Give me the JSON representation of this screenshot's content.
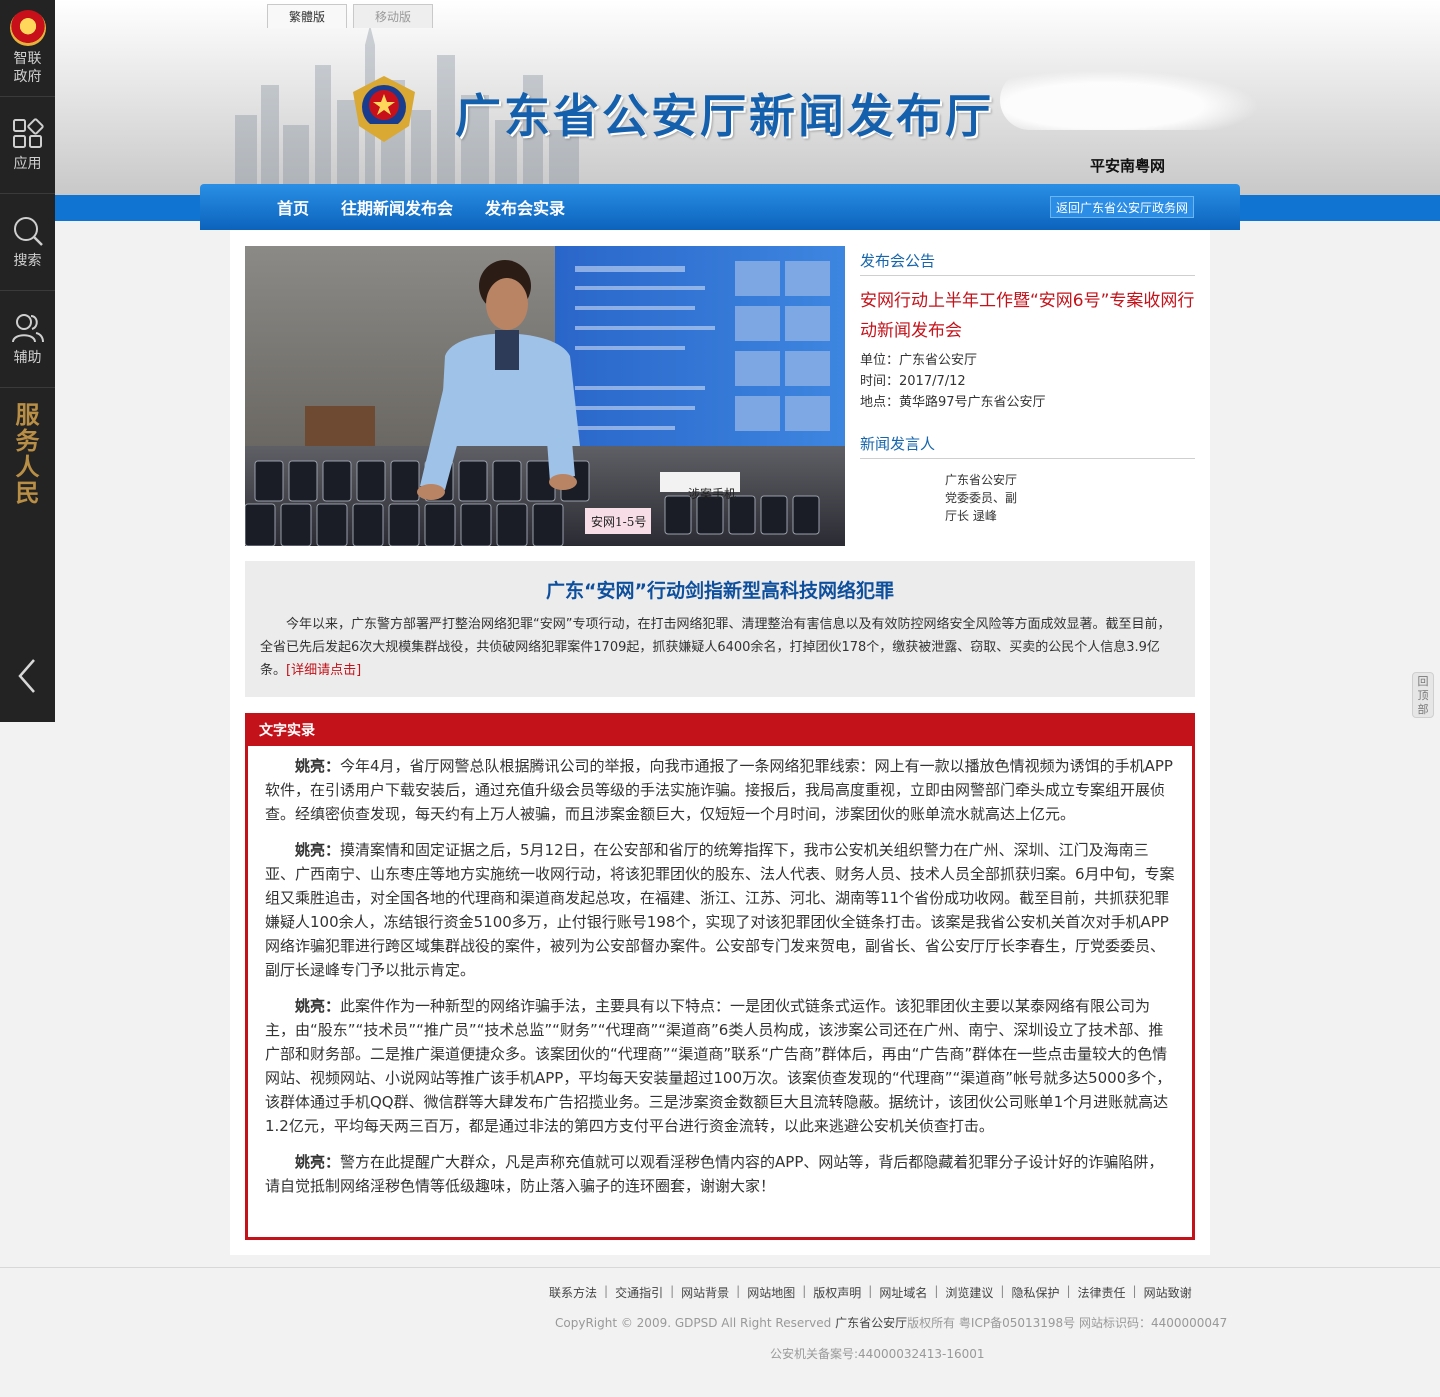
{
  "sidebar": {
    "items": [
      {
        "label": "智联政府",
        "icon": "government-emblem-icon"
      },
      {
        "label": "应用",
        "icon": "apps-grid-icon"
      },
      {
        "label": "搜索",
        "icon": "search-icon"
      },
      {
        "label": "辅助",
        "icon": "people-icon"
      }
    ],
    "slogan": [
      "服",
      "务",
      "人",
      "民"
    ],
    "collapse_icon": "chevron-left-icon"
  },
  "header": {
    "tabs": [
      "繁體版",
      "移动版"
    ],
    "site_title": "广东省公安厅新闻发布厅",
    "sub_brand": "平安南粤网"
  },
  "nav": {
    "links": [
      "首页",
      "往期新闻发布会",
      "发布会实录"
    ],
    "back_button": "返回广东省公安厅政务网"
  },
  "photo": {
    "sign_1": "安网1-5号",
    "sign_2": "涉案手机"
  },
  "announcement": {
    "section_title": "发布会公告",
    "title": "安网行动上半年工作暨“安网6号”专案收网行动新闻发布会",
    "unit_label": "单位：",
    "unit": "广东省公安厅",
    "time_label": "时间：",
    "time": "2017/7/12",
    "place_label": "地点：",
    "place": "黄华路97号广东省公安厅"
  },
  "spokesman": {
    "section_title": "新闻发言人",
    "name": "广东省公安厅党委委员、副厅长 逯峰"
  },
  "summary": {
    "title": "广东“安网”行动剑指新型高科技网络犯罪",
    "text": "今年以来，广东警方部署严打整治网络犯罪“安网”专项行动，在打击网络犯罪、清理整治有害信息以及有效防控网络安全风险等方面成效显著。截至目前，全省已先后发起6次大规模集群战役，共侦破网络犯罪案件1709起，抓获嫌疑人6400余名，打掉团伙178个，缴获被泄露、窃取、买卖的公民个人信息3.9亿条。",
    "more_link": "[详细请点击]"
  },
  "transcript": {
    "title": "文字实录",
    "paragraphs": [
      {
        "speaker": "姚亮：",
        "text": "今年4月，省厅网警总队根据腾讯公司的举报，向我市通报了一条网络犯罪线索：网上有一款以播放色情视频为诱饵的手机APP软件，在引诱用户下载安装后，通过充值升级会员等级的手法实施诈骗。接报后，我局高度重视，立即由网警部门牵头成立专案组开展侦查。经缜密侦查发现，每天约有上万人被骗，而且涉案金额巨大，仅短短一个月时间，涉案团伙的账单流水就高达上亿元。"
      },
      {
        "speaker": "姚亮：",
        "text": "摸清案情和固定证据之后，5月12日，在公安部和省厅的统筹指挥下，我市公安机关组织警力在广州、深圳、江门及海南三亚、广西南宁、山东枣庄等地方实施统一收网行动，将该犯罪团伙的股东、法人代表、财务人员、技术人员全部抓获归案。6月中旬，专案组又乘胜追击，对全国各地的代理商和渠道商发起总攻，在福建、浙江、江苏、河北、湖南等11个省份成功收网。截至目前，共抓获犯罪嫌疑人100余人，冻结银行资金5100多万，止付银行账号198个，实现了对该犯罪团伙全链条打击。该案是我省公安机关首次对手机APP网络诈骗犯罪进行跨区域集群战役的案件，被列为公安部督办案件。公安部专门发来贺电，副省长、省公安厅厅长李春生，厅党委委员、副厅长逯峰专门予以批示肯定。"
      },
      {
        "speaker": "姚亮：",
        "text": "此案件作为一种新型的网络诈骗手法，主要具有以下特点：一是团伙式链条式运作。该犯罪团伙主要以某泰网络有限公司为主，由“股东”“技术员”“推广员”“技术总监”“财务”“代理商”“渠道商”6类人员构成，该涉案公司还在广州、南宁、深圳设立了技术部、推广部和财务部。二是推广渠道便捷众多。该案团伙的“代理商”“渠道商”联系“广告商”群体后，再由“广告商”群体在一些点击量较大的色情网站、视频网站、小说网站等推广该手机APP，平均每天安装量超过100万次。该案侦查发现的“代理商”“渠道商”帐号就多达5000多个，该群体通过手机QQ群、微信群等大肆发布广告招揽业务。三是涉案资金数额巨大且流转隐蔽。据统计，该团伙公司账单1个月进账就高达1.2亿元，平均每天两三百万，都是通过非法的第四方支付平台进行资金流转，以此来逃避公安机关侦查打击。"
      },
      {
        "speaker": "姚亮：",
        "text": "警方在此提醒广大群众，凡是声称充值就可以观看淫秽色情内容的APP、网站等，背后都隐藏着犯罪分子设计好的诈骗陷阱，请自觉抵制网络淫秽色情等低级趣味，防止落入骗子的连环圈套，谢谢大家！"
      }
    ]
  },
  "back_to_top": "回顶部",
  "footer": {
    "links": [
      "联系方法",
      "交通指引",
      "网站背景",
      "网站地图",
      "版权声明",
      "网址域名",
      "浏览建议",
      "隐私保护",
      "法律责任",
      "网站致谢"
    ],
    "copyright_prefix": "CopyRight © 2009. GDPSD All Right Reserved",
    "copyright_org": "广东省公安厅",
    "copyright_suffix": "版权所有 粤ICP备05013198号 网站标识码：4400000047",
    "beian": "公安机关备案号:44000032413-16001"
  },
  "colors": {
    "brand_blue": "#1560ad",
    "nav_blue": "#0f74d2",
    "accent_red": "#c4121a",
    "sidebar_bg": "#232323"
  }
}
